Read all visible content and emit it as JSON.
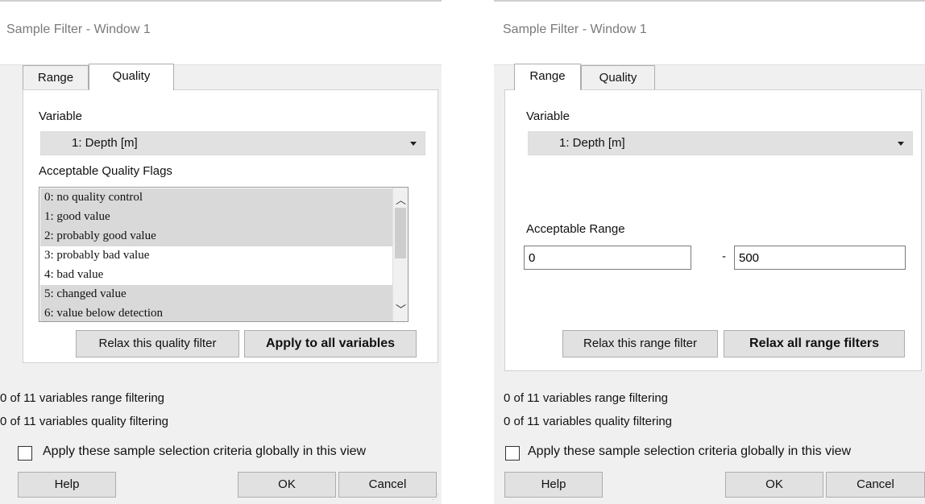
{
  "window1": {
    "title": "Sample Filter - Window 1",
    "tabs": [
      "Range",
      "Quality"
    ],
    "active_tab": "Quality",
    "variable_label": "Variable",
    "variable_value": "1: Depth [m]",
    "flags_label": "Acceptable Quality Flags",
    "flags": [
      {
        "label": "0: no quality control",
        "selected": true
      },
      {
        "label": "1: good value",
        "selected": true
      },
      {
        "label": "2: probably good value",
        "selected": true
      },
      {
        "label": "3: probably bad value",
        "selected": false
      },
      {
        "label": "4: bad value",
        "selected": false
      },
      {
        "label": "5: changed value",
        "selected": true
      },
      {
        "label": "6: value below detection",
        "selected": true
      }
    ],
    "relax_button": "Relax this quality filter",
    "apply_all_button": "Apply to all variables",
    "status_range": "0 of 11 variables range filtering",
    "status_quality": "0 of 11 variables quality filtering",
    "global_checkbox": "Apply these sample selection criteria globally in this view",
    "global_checked": false,
    "help_button": "Help",
    "ok_button": "OK",
    "cancel_button": "Cancel"
  },
  "window2": {
    "title": "Sample Filter - Window 1",
    "tabs": [
      "Range",
      "Quality"
    ],
    "active_tab": "Range",
    "variable_label": "Variable",
    "variable_value": "1: Depth [m]",
    "range_label": "Acceptable Range",
    "range_min": "0",
    "range_separator": "-",
    "range_max": "500",
    "relax_button": "Relax this range filter",
    "relax_all_button": "Relax all range filters",
    "status_range": "0 of 11 variables range filtering",
    "status_quality": "0 of 11 variables quality filtering",
    "global_checkbox": "Apply these sample selection criteria globally in this view",
    "global_checked": false,
    "help_button": "Help",
    "ok_button": "OK",
    "cancel_button": "Cancel"
  }
}
